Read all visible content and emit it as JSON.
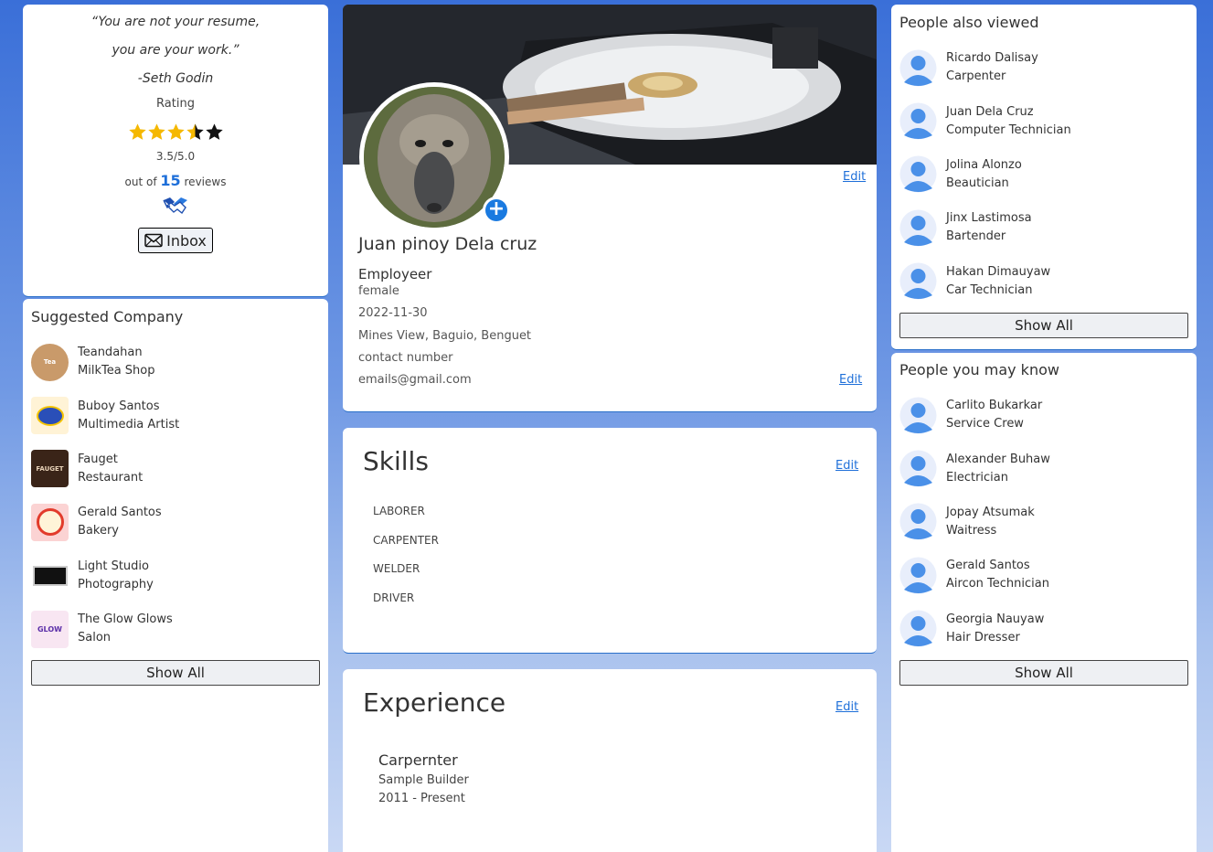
{
  "quote": {
    "line1": "“You are not your resume,",
    "line2": "you are your work.”",
    "author": "-Seth Godin"
  },
  "rating": {
    "label": "Rating",
    "value": 3.5,
    "max": 5,
    "score_text": "3.5/5.0",
    "reviews_prefix": "out of",
    "reviews_count": "15",
    "reviews_suffix": "reviews"
  },
  "inbox_label": "Inbox",
  "suggested_company": {
    "title": "Suggested Company",
    "items": [
      {
        "name": "Teandahan",
        "type": "MilkTea Shop"
      },
      {
        "name": "Buboy Santos",
        "type": "Multimedia Artist"
      },
      {
        "name": "Fauget",
        "type": "Restaurant"
      },
      {
        "name": "Gerald Santos",
        "type": "Bakery"
      },
      {
        "name": "Light Studio",
        "type": "Photography"
      },
      {
        "name": "The Glow Glows",
        "type": "Salon"
      }
    ],
    "show_all": "Show All"
  },
  "profile": {
    "edit_label": "Edit",
    "name": "Juan pinoy Dela cruz",
    "role": "Employeer",
    "gender": "female",
    "date": "2022-11-30",
    "address": "Mines View, Baguio, Benguet",
    "contact": "contact number",
    "email": "emails@gmail.com"
  },
  "skills": {
    "title": "Skills",
    "edit_label": "Edit",
    "items": [
      "LABORER",
      "CARPENTER",
      "WELDER",
      "DRIVER"
    ]
  },
  "experience": {
    "title": "Experience",
    "edit_label": "Edit",
    "items": [
      {
        "title": "Carpernter",
        "company": "Sample Builder",
        "period": "2011 - Present"
      }
    ]
  },
  "people_also_viewed": {
    "title": "People also viewed",
    "items": [
      {
        "name": "Ricardo Dalisay",
        "job": "Carpenter"
      },
      {
        "name": "Juan Dela Cruz",
        "job": "Computer Technician"
      },
      {
        "name": "Jolina Alonzo",
        "job": "Beautician"
      },
      {
        "name": "Jinx Lastimosa",
        "job": "Bartender"
      },
      {
        "name": "Hakan Dimauyaw",
        "job": "Car Technician"
      }
    ],
    "show_all": "Show All"
  },
  "people_you_may_know": {
    "title": "People you may know",
    "items": [
      {
        "name": "Carlito Bukarkar",
        "job": "Service Crew"
      },
      {
        "name": "Alexander Buhaw",
        "job": "Electrician"
      },
      {
        "name": "Jopay Atsumak",
        "job": "Waitress"
      },
      {
        "name": "Gerald Santos",
        "job": "Aircon Technician"
      },
      {
        "name": "Georgia Nauyaw",
        "job": "Hair Dresser"
      }
    ],
    "show_all": "Show All"
  },
  "colors": {
    "accent": "#1e6fd9",
    "star_filled": "#f5b800",
    "star_empty": "#111111",
    "person_icon": "#4a90e8"
  }
}
